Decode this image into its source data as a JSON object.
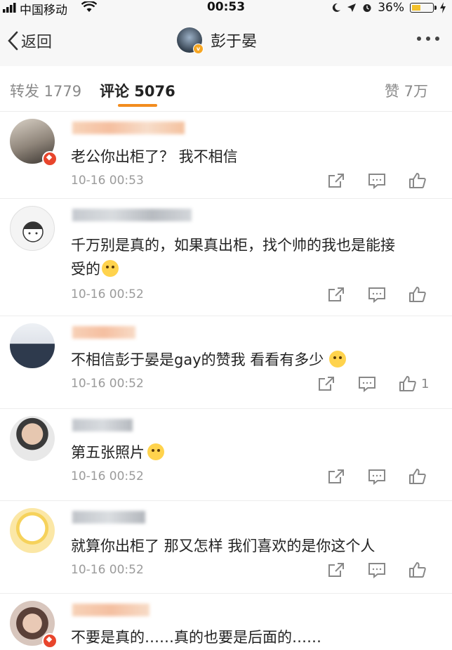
{
  "status_bar": {
    "carrier": "中国移动",
    "time": "00:53",
    "battery": "36%",
    "battery_level": 0.36
  },
  "nav": {
    "back_label": "返回",
    "title": "彭于晏"
  },
  "tabs": [
    {
      "label": "转发 1779"
    },
    {
      "label": "评论 5076"
    },
    {
      "label": "赞 7万"
    }
  ],
  "comments": [
    {
      "name": "",
      "text": "老公你出柜了？ 我不相信",
      "time": "10-16 00:53",
      "likes": ""
    },
    {
      "name": "",
      "text": "千万别是真的，如果真出柜，找个帅的我也是能接",
      "text2": "受的",
      "time": "10-16 00:52",
      "likes": ""
    },
    {
      "name": "",
      "text": "不相信彭于晏是gay的赞我 看看有多少",
      "time": "10-16 00:52",
      "likes": "1"
    },
    {
      "name": "",
      "text": "第五张照片",
      "time": "10-16 00:52",
      "likes": ""
    },
    {
      "name": "",
      "text": "就算你出柜了 那又怎样 我们喜欢的是你这个人",
      "time": "10-16 00:52",
      "likes": ""
    },
    {
      "name": "",
      "text": "不要是真的……真的也要是后面的……",
      "time": "",
      "likes": ""
    }
  ],
  "colors": {
    "accent": "#f28c1e",
    "name_orange": "#f08a3c",
    "verified_red": "#e8452c",
    "muted": "#9b9b9b"
  },
  "icons": [
    "back-chevron-icon",
    "more-dots-icon",
    "forward-icon",
    "comment-icon",
    "like-icon",
    "wifi-icon",
    "signal-icon",
    "battery-icon"
  ]
}
